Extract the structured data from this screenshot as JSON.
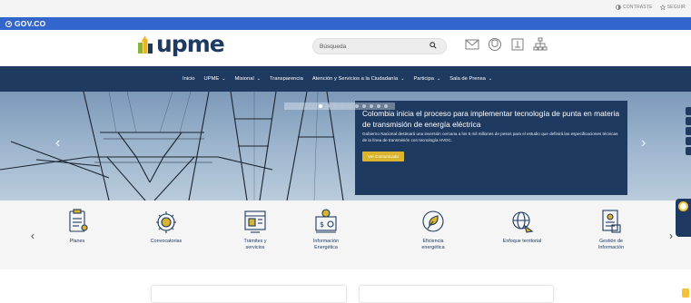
{
  "top_bar": {
    "actions": [
      {
        "icon": "contrast-icon",
        "label": "CONTRASTE"
      },
      {
        "icon": "star-icon",
        "label": "SEGUIR"
      }
    ]
  },
  "gov_bar": {
    "label": "GOV.CO"
  },
  "header": {
    "logo_text": "upme",
    "search": {
      "placeholder": "Búsqueda"
    },
    "icons": [
      "mail-icon",
      "location-icon",
      "document-icon",
      "sitemap-icon"
    ]
  },
  "nav": {
    "items": [
      {
        "label": "Inicio",
        "dropdown": false
      },
      {
        "label": "UPME",
        "dropdown": true
      },
      {
        "label": "Misional",
        "dropdown": true
      },
      {
        "label": "Transparencia",
        "dropdown": false
      },
      {
        "label": "Atención y Servicios a la Ciudadanía",
        "dropdown": true
      },
      {
        "label": "Participa",
        "dropdown": true
      },
      {
        "label": "Sala de Prensa",
        "dropdown": true
      }
    ]
  },
  "hero": {
    "title": "Colombia inicia el proceso para implementar tecnología de punta en materia de transmisión de energía eléctrica",
    "body": "Gobierno Nacional destinará una inversión cercana a los 5 mil millones de pesos para el estudio que definirá las especificaciones técnicas de la línea de transmisión con tecnología HVDC.",
    "button": "Ver Comunicado",
    "slides": 10,
    "active_slide": 1
  },
  "quick_links": [
    {
      "label": "Planes",
      "icon": "plans-icon"
    },
    {
      "label": "Convocatorias",
      "icon": "gear-lightbulb-icon"
    },
    {
      "label": "Trámites y servicios",
      "icon": "forms-icon"
    },
    {
      "label": "Información Energética",
      "icon": "energy-info-icon"
    },
    {
      "label": "Eficiencia energética",
      "icon": "efficiency-icon"
    },
    {
      "label": "Enfoque territorial",
      "icon": "globe-icon"
    },
    {
      "label": "Gestión de Información",
      "icon": "info-management-icon"
    }
  ],
  "colors": {
    "gov_blue": "#3366cc",
    "nav_dark": "#1f3a60",
    "accent_yellow": "#d9b42c"
  }
}
